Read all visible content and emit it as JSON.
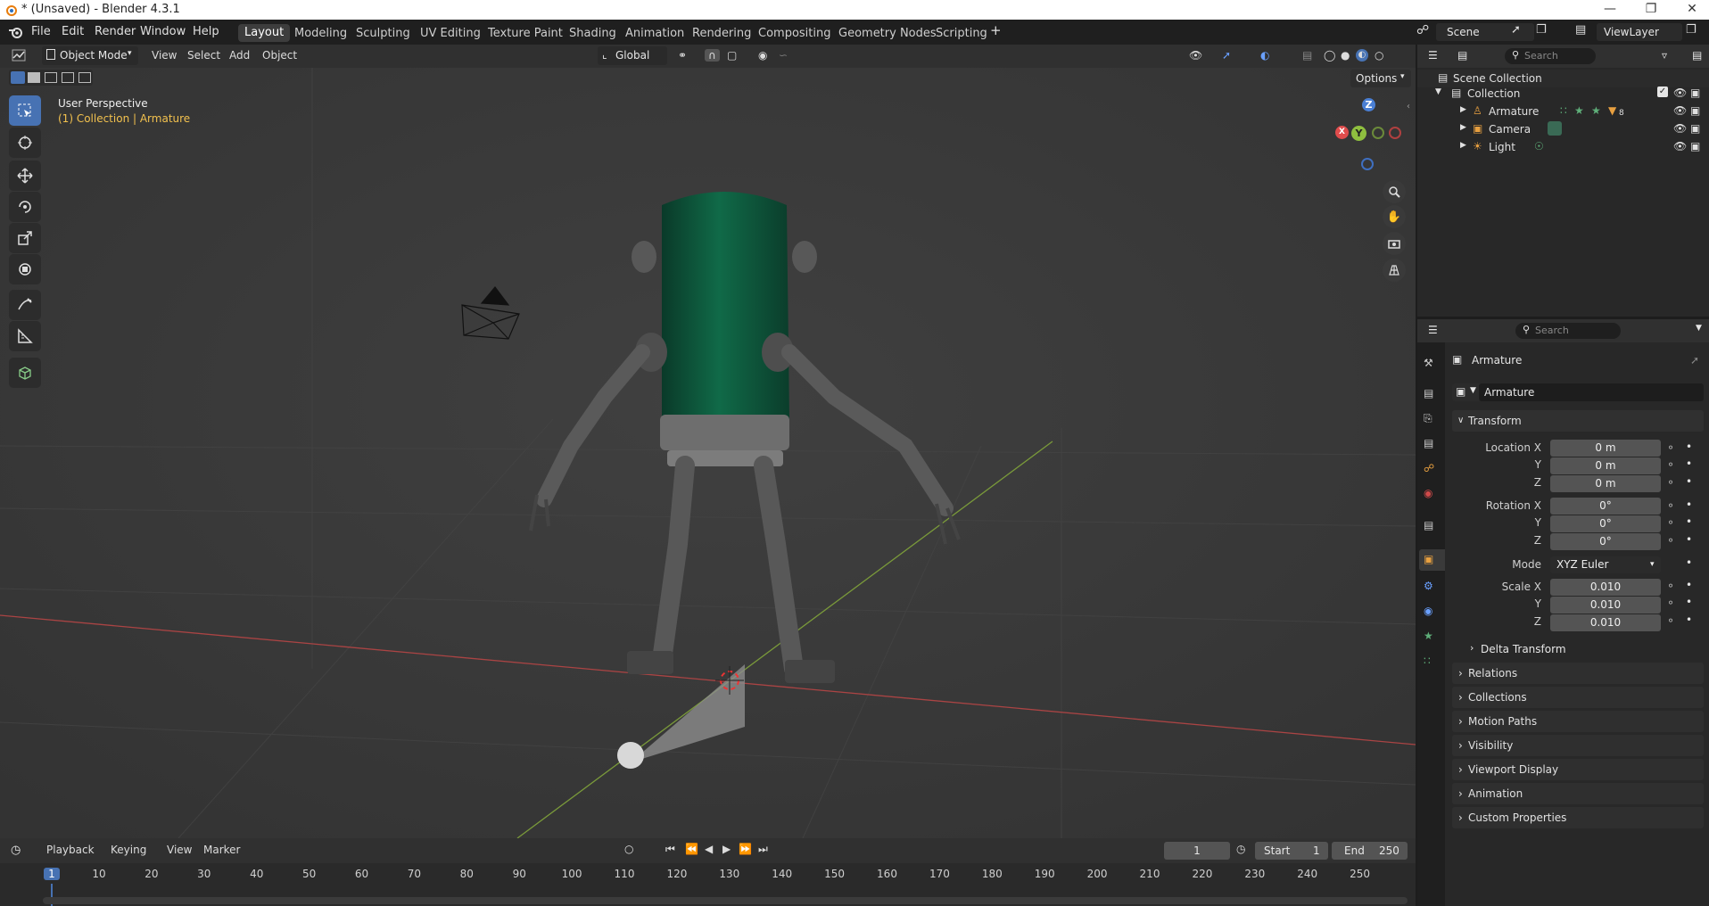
{
  "window": {
    "title": "* (Unsaved) - Blender 4.3.1"
  },
  "menu": [
    "File",
    "Edit",
    "Render",
    "Window",
    "Help"
  ],
  "workspaces": [
    "Layout",
    "Modeling",
    "Sculpting",
    "UV Editing",
    "Texture Paint",
    "Shading",
    "Animation",
    "Rendering",
    "Compositing",
    "Geometry Nodes",
    "Scripting"
  ],
  "active_workspace": "Layout",
  "scene": {
    "name": "Scene",
    "view_layer": "ViewLayer"
  },
  "viewport_header": {
    "mode": "Object Mode",
    "menus": [
      "View",
      "Select",
      "Add",
      "Object"
    ],
    "orientation": "Global",
    "options_label": "Options"
  },
  "viewport": {
    "perspective": "User Perspective",
    "context": "(1) Collection | Armature",
    "gizmo_axes": {
      "x": "X",
      "y": "Y",
      "z": "Z"
    }
  },
  "outliner": {
    "search_placeholder": "Search",
    "root": "Scene Collection",
    "collection": "Collection",
    "items": [
      {
        "name": "Armature",
        "icon": "armature-icon"
      },
      {
        "name": "Camera",
        "icon": "camera-icon"
      },
      {
        "name": "Light",
        "icon": "light-icon"
      }
    ],
    "armature_badge": "8"
  },
  "properties": {
    "search_placeholder": "Search",
    "object_name": "Armature",
    "data_name": "Armature",
    "transform_label": "Transform",
    "location": {
      "label": "Location X",
      "x": "0 m",
      "y": "0 m",
      "z": "0 m"
    },
    "rotation": {
      "label": "Rotation X",
      "x": "0°",
      "y": "0°",
      "z": "0°"
    },
    "mode": {
      "label": "Mode",
      "value": "XYZ Euler"
    },
    "scale": {
      "label": "Scale X",
      "x": "0.010",
      "y": "0.010",
      "z": "0.010"
    },
    "axis_y": "Y",
    "axis_z": "Z",
    "delta_transform": "Delta Transform",
    "panels": [
      "Relations",
      "Collections",
      "Motion Paths",
      "Visibility",
      "Viewport Display",
      "Animation",
      "Custom Properties"
    ]
  },
  "timeline": {
    "menus": [
      "Playback",
      "Keying",
      "View",
      "Marker"
    ],
    "current_frame": "1",
    "start_label": "Start",
    "start": "1",
    "end_label": "End",
    "end": "250",
    "ruler": [
      "1",
      "10",
      "20",
      "30",
      "40",
      "50",
      "60",
      "70",
      "80",
      "90",
      "100",
      "110",
      "120",
      "130",
      "140",
      "150",
      "160",
      "170",
      "180",
      "190",
      "200",
      "210",
      "220",
      "230",
      "240",
      "250"
    ]
  },
  "colors": {
    "accent": "#4772b3",
    "x_axis": "#e04c4c",
    "y_axis": "#8fbf3f",
    "z_axis": "#4a7fd4",
    "robot_body": "#0f5a3e"
  }
}
